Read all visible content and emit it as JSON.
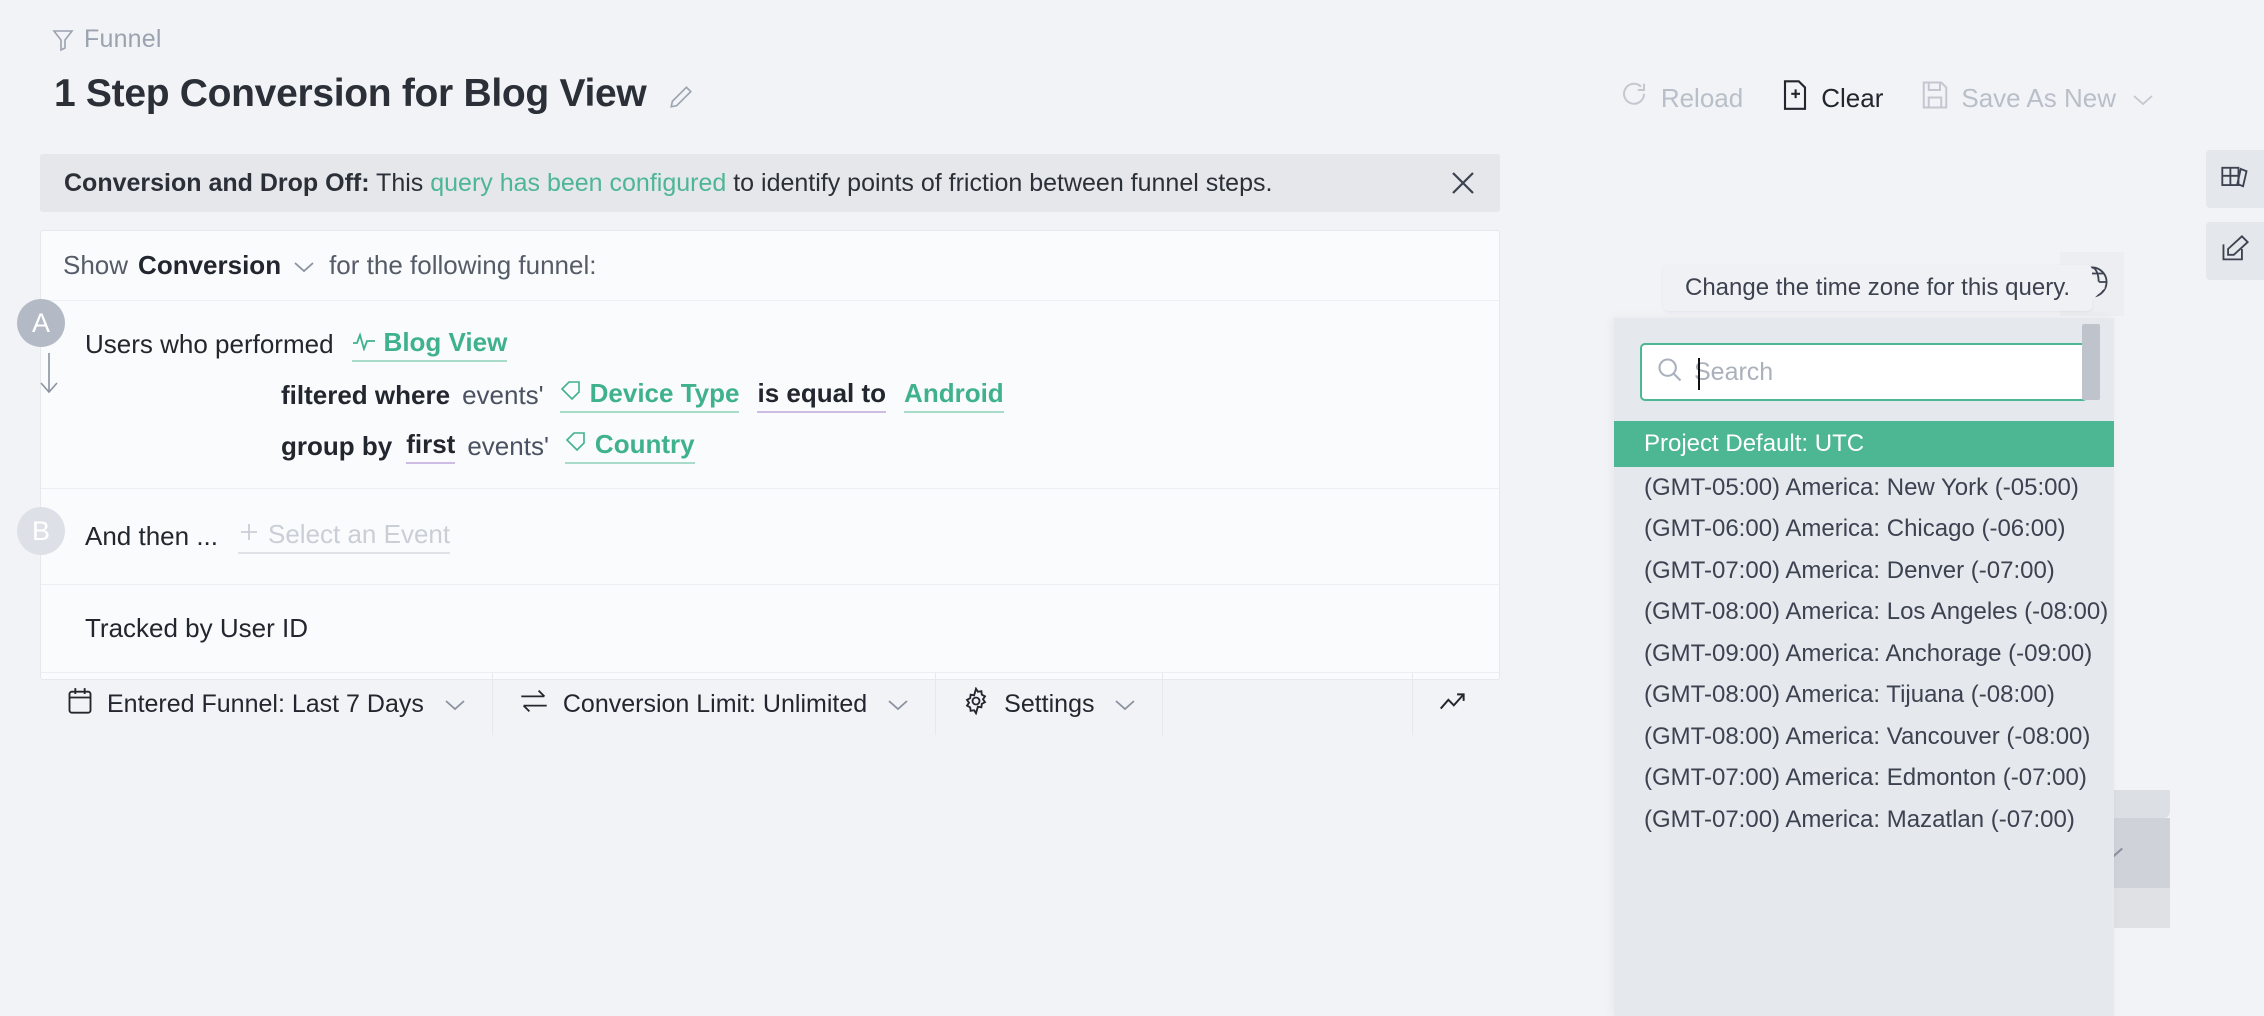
{
  "breadcrumb": {
    "label": "Funnel",
    "icon": "funnel-icon"
  },
  "header": {
    "title": "1 Step Conversion for Blog View",
    "edit_icon": "pencil-icon",
    "actions": [
      {
        "label": "Reload",
        "icon": "reload-icon",
        "state": "disabled"
      },
      {
        "label": "Clear",
        "icon": "file-plus-icon",
        "state": "enabled"
      },
      {
        "label": "Save As New",
        "icon": "save-icon",
        "state": "disabled",
        "caret": "chevron-down-icon"
      }
    ]
  },
  "banner": {
    "bold_prefix": "Conversion and Drop Off:",
    "text_before": " This ",
    "link_text": "query has been configured",
    "text_after": " to identify points of friction between funnel steps.",
    "close_icon": "close-icon"
  },
  "query": {
    "show_prefix": "Show",
    "show_value": "Conversion",
    "show_suffix": "for the following funnel:",
    "steps": [
      {
        "badge": "A",
        "lead": "Users who performed",
        "event": "Blog View",
        "event_icon": "pulse-icon",
        "filters": [
          {
            "keyword": "filtered where",
            "scope": "events'",
            "property": "Device Type",
            "property_icon": "tag-icon",
            "operator": "is equal to",
            "value": "Android"
          }
        ],
        "group_by": {
          "keyword": "group by",
          "occurrence": "first",
          "scope": "events'",
          "property": "Country",
          "property_icon": "tag-icon"
        }
      },
      {
        "badge": "B",
        "lead": "And then ...",
        "add_event_label": "Select an Event",
        "add_event_icon": "plus-icon"
      }
    ],
    "tracked_by": "Tracked by User ID"
  },
  "footer_toolbar": {
    "items": [
      {
        "label": "Entered Funnel: Last 7 Days",
        "icon": "calendar-icon",
        "caret": "chevron-down-icon"
      },
      {
        "label": "Conversion Limit: Unlimited",
        "icon": "convert-icon",
        "caret": "chevron-down-icon"
      },
      {
        "label": "Settings",
        "icon": "gear-icon",
        "caret": "chevron-down-icon"
      }
    ],
    "trend_icon": "trending-up-icon"
  },
  "right_rail": [
    {
      "icon": "table-panel-icon",
      "name": "data-table-toggle"
    },
    {
      "icon": "edit-panel-icon",
      "name": "annotate-toggle"
    }
  ],
  "timezone": {
    "trigger_icon": "globe-icon",
    "tooltip": "Change the time zone for this query.",
    "search_placeholder": "Search",
    "search_value": "",
    "search_icon": "search-icon",
    "selected": "Project Default: UTC",
    "options": [
      "Project Default: UTC",
      "(GMT-05:00) America: New York (-05:00)",
      "(GMT-06:00) America: Chicago (-06:00)",
      "(GMT-07:00) America: Denver (-07:00)",
      "(GMT-08:00) America: Los Angeles (-08:00)",
      "(GMT-09:00) America: Anchorage (-09:00)",
      "(GMT-08:00) America: Tijuana (-08:00)",
      "(GMT-08:00) America: Vancouver (-08:00)",
      "(GMT-07:00) America: Edmonton (-07:00)",
      "(GMT-07:00) America: Mazatlan (-07:00)"
    ]
  },
  "colors": {
    "accent_green": "#4db693",
    "link_green": "#3fb28d",
    "operator_purple": "#cdbde4",
    "panel_bg": "#e5e8ed",
    "page_bg": "#f2f3f6"
  }
}
